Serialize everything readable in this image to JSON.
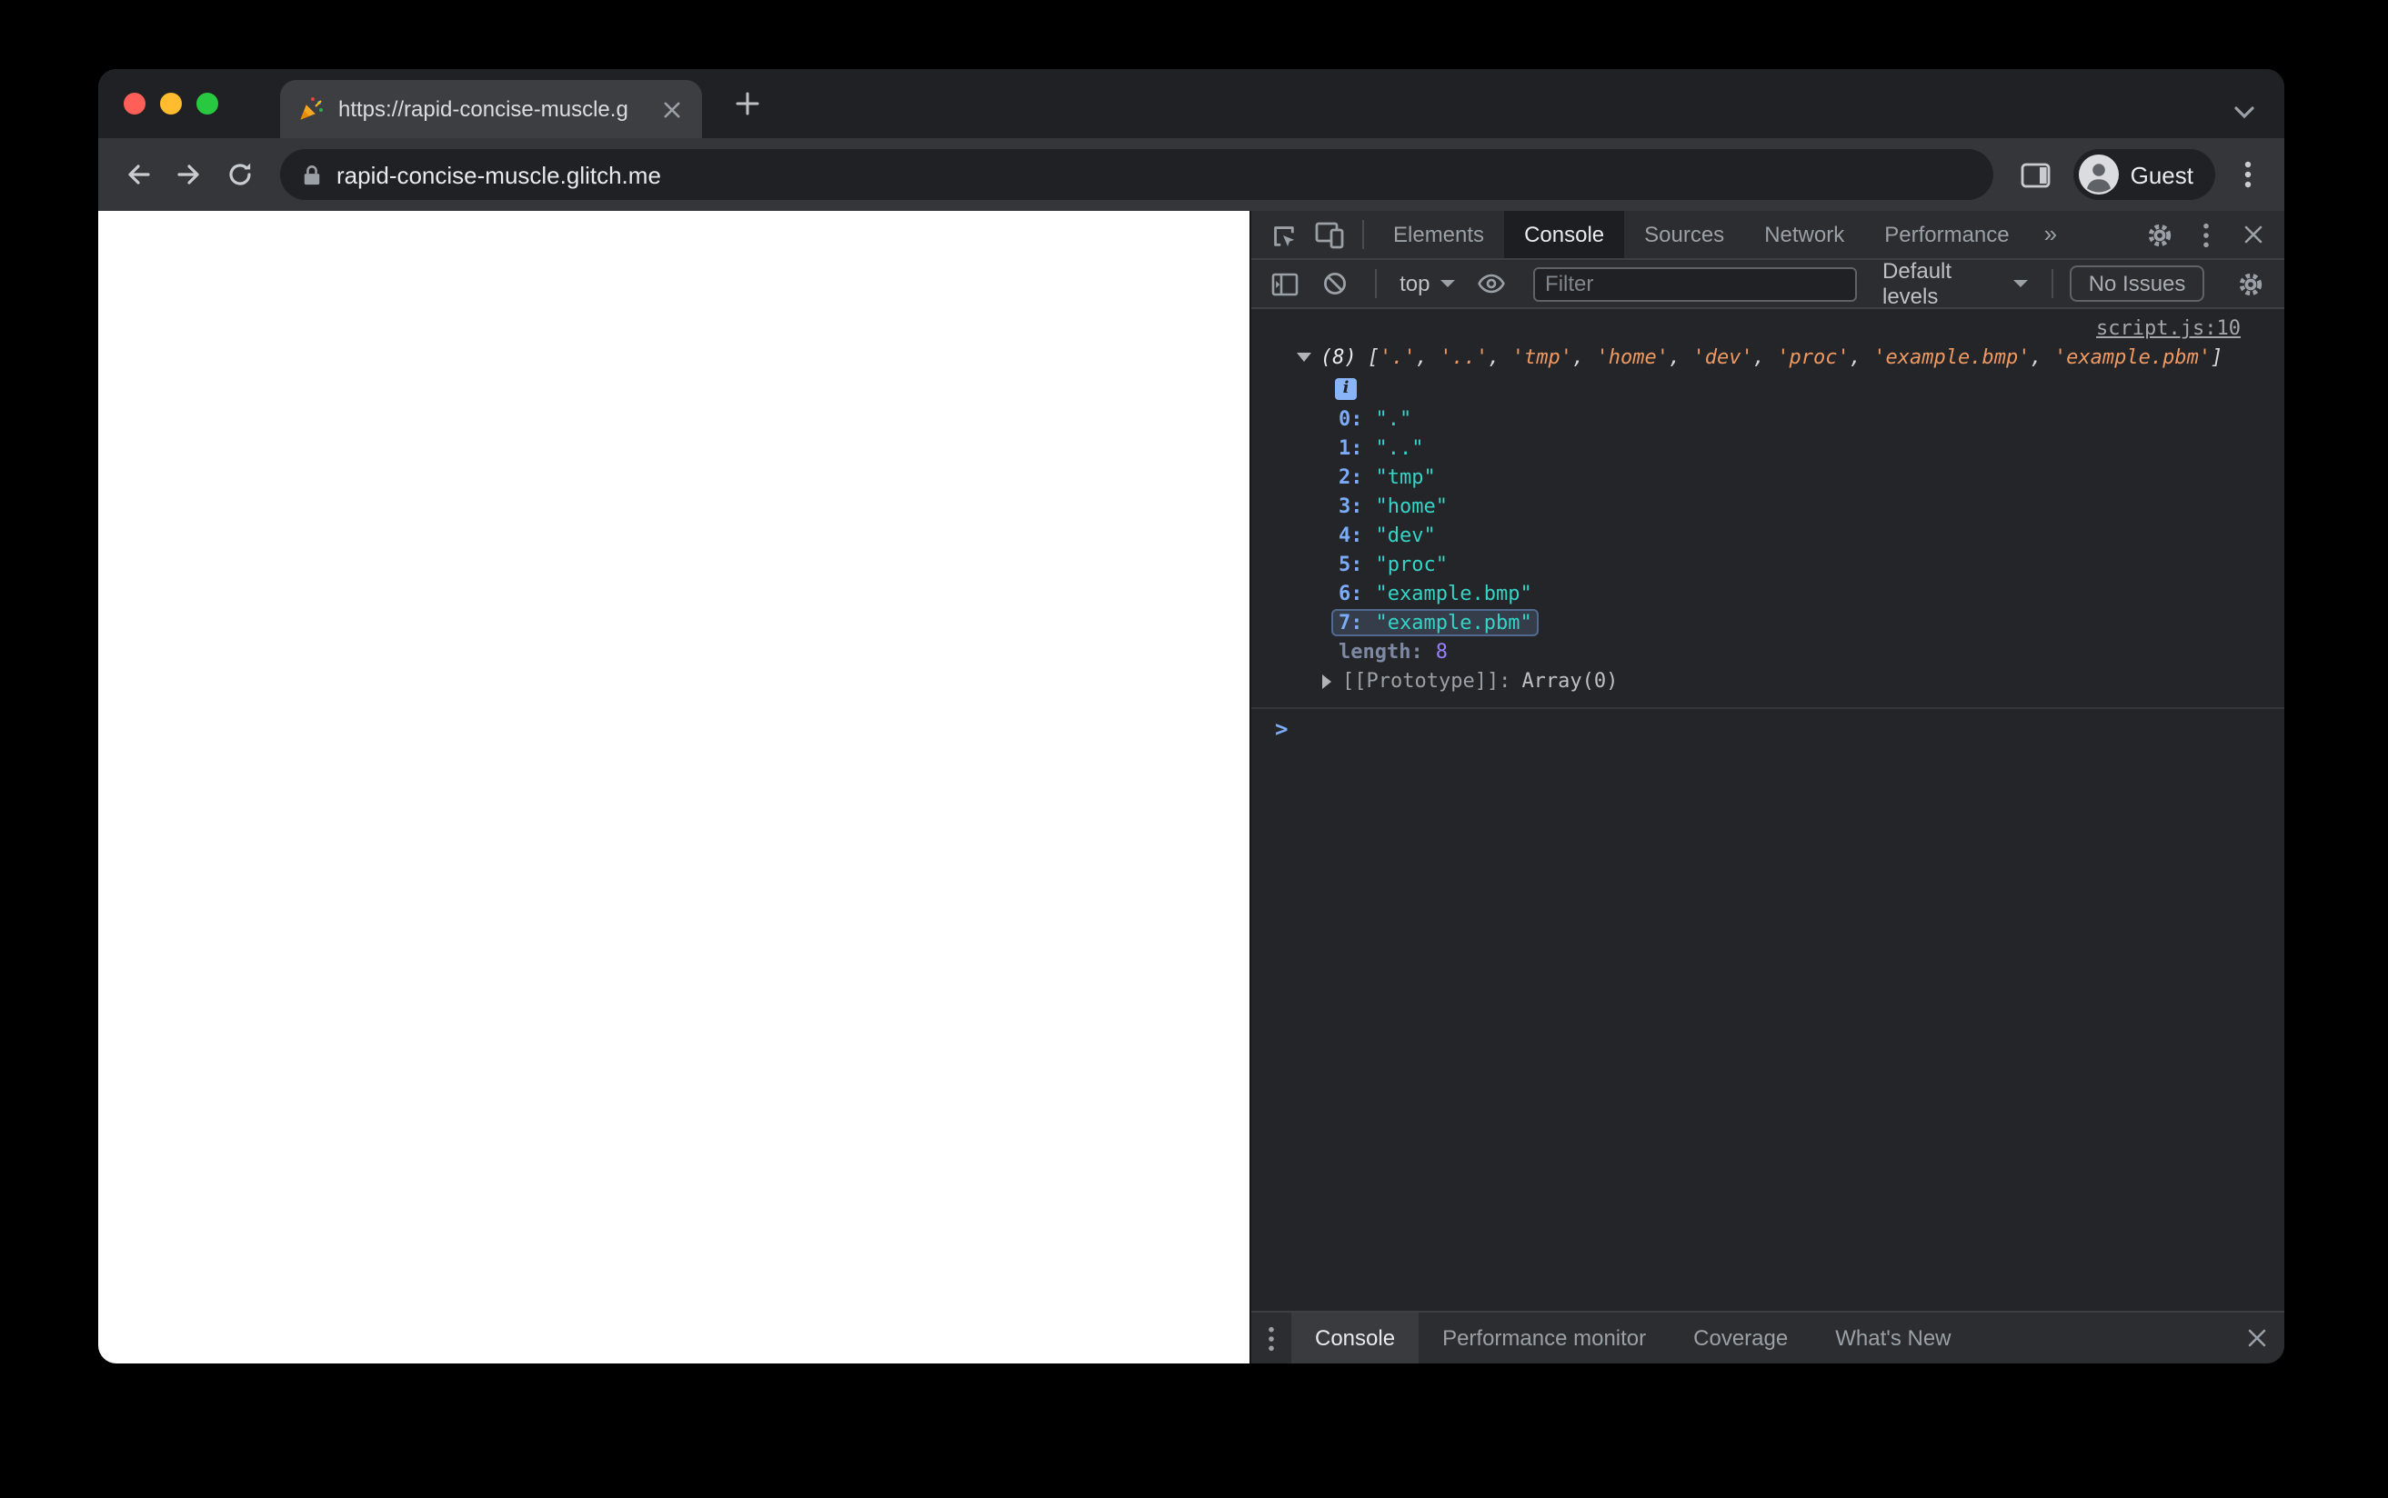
{
  "browser": {
    "tab_title": "https://rapid-concise-muscle.g",
    "url": "rapid-concise-muscle.glitch.me",
    "profile": "Guest",
    "favicon": "party-popper"
  },
  "devtools": {
    "panel_tabs": {
      "elements": "Elements",
      "console": "Console",
      "sources": "Sources",
      "network": "Network",
      "performance": "Performance",
      "more": "»"
    },
    "toolbar": {
      "context": "top",
      "filter_placeholder": "Filter",
      "levels": "Default levels",
      "issues": "No Issues"
    },
    "console": {
      "source_link": "script.js:10",
      "info_badge": "i",
      "prompt": ">",
      "preview": {
        "count": "(8)",
        "open": "[",
        "separator": ", ",
        "close": "]",
        "items": [
          "'.'",
          "'..'",
          "'tmp'",
          "'home'",
          "'dev'",
          "'proc'",
          "'example.bmp'",
          "'example.pbm'"
        ]
      },
      "entries": [
        {
          "key": "0:",
          "value": "\".\""
        },
        {
          "key": "1:",
          "value": "\"..\""
        },
        {
          "key": "2:",
          "value": "\"tmp\""
        },
        {
          "key": "3:",
          "value": "\"home\""
        },
        {
          "key": "4:",
          "value": "\"dev\""
        },
        {
          "key": "5:",
          "value": "\"proc\""
        },
        {
          "key": "6:",
          "value": "\"example.bmp\""
        },
        {
          "key": "7:",
          "value": "\"example.pbm\"",
          "highlighted": true
        }
      ],
      "length_key": "length:",
      "length_value": "8",
      "proto_key": "[[Prototype]]:",
      "proto_value": "Array(0)"
    },
    "drawer": {
      "console": "Console",
      "perf_monitor": "Performance monitor",
      "coverage": "Coverage",
      "whats_new": "What's New"
    }
  },
  "colors": {
    "traffic_red": "#ff5f57",
    "traffic_yellow": "#febc2e",
    "traffic_green": "#28c840",
    "string_preview": "#ee9862",
    "string_value": "#35d4c7",
    "index_blue": "#7cacf8",
    "number_purple": "#9980ff",
    "devtools_bg": "#242528",
    "toolbar_bg": "#2b2d30"
  }
}
